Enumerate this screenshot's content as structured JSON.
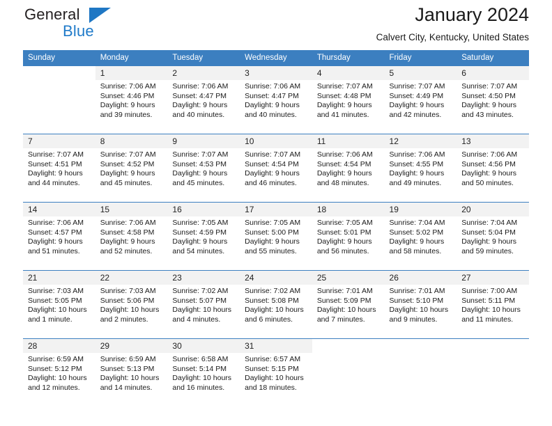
{
  "brand": {
    "name_part1": "General",
    "name_part2": "Blue",
    "triangle_color": "#1f77c4",
    "blue_color": "#1f7ac9"
  },
  "header": {
    "title": "January 2024",
    "subtitle": "Calvert City, Kentucky, United States"
  },
  "theme": {
    "header_blue": "#3c7fc0",
    "daynum_gray": "#f2f2f2",
    "text": "#1a1a1a"
  },
  "calendar": {
    "weekday_headers": [
      "Sunday",
      "Monday",
      "Tuesday",
      "Wednesday",
      "Thursday",
      "Friday",
      "Saturday"
    ],
    "weeks": [
      [
        {
          "day": "",
          "lines": []
        },
        {
          "day": "1",
          "lines": [
            "Sunrise: 7:06 AM",
            "Sunset: 4:46 PM",
            "Daylight: 9 hours",
            "and 39 minutes."
          ]
        },
        {
          "day": "2",
          "lines": [
            "Sunrise: 7:06 AM",
            "Sunset: 4:47 PM",
            "Daylight: 9 hours",
            "and 40 minutes."
          ]
        },
        {
          "day": "3",
          "lines": [
            "Sunrise: 7:06 AM",
            "Sunset: 4:47 PM",
            "Daylight: 9 hours",
            "and 40 minutes."
          ]
        },
        {
          "day": "4",
          "lines": [
            "Sunrise: 7:07 AM",
            "Sunset: 4:48 PM",
            "Daylight: 9 hours",
            "and 41 minutes."
          ]
        },
        {
          "day": "5",
          "lines": [
            "Sunrise: 7:07 AM",
            "Sunset: 4:49 PM",
            "Daylight: 9 hours",
            "and 42 minutes."
          ]
        },
        {
          "day": "6",
          "lines": [
            "Sunrise: 7:07 AM",
            "Sunset: 4:50 PM",
            "Daylight: 9 hours",
            "and 43 minutes."
          ]
        }
      ],
      [
        {
          "day": "7",
          "lines": [
            "Sunrise: 7:07 AM",
            "Sunset: 4:51 PM",
            "Daylight: 9 hours",
            "and 44 minutes."
          ]
        },
        {
          "day": "8",
          "lines": [
            "Sunrise: 7:07 AM",
            "Sunset: 4:52 PM",
            "Daylight: 9 hours",
            "and 45 minutes."
          ]
        },
        {
          "day": "9",
          "lines": [
            "Sunrise: 7:07 AM",
            "Sunset: 4:53 PM",
            "Daylight: 9 hours",
            "and 45 minutes."
          ]
        },
        {
          "day": "10",
          "lines": [
            "Sunrise: 7:07 AM",
            "Sunset: 4:54 PM",
            "Daylight: 9 hours",
            "and 46 minutes."
          ]
        },
        {
          "day": "11",
          "lines": [
            "Sunrise: 7:06 AM",
            "Sunset: 4:54 PM",
            "Daylight: 9 hours",
            "and 48 minutes."
          ]
        },
        {
          "day": "12",
          "lines": [
            "Sunrise: 7:06 AM",
            "Sunset: 4:55 PM",
            "Daylight: 9 hours",
            "and 49 minutes."
          ]
        },
        {
          "day": "13",
          "lines": [
            "Sunrise: 7:06 AM",
            "Sunset: 4:56 PM",
            "Daylight: 9 hours",
            "and 50 minutes."
          ]
        }
      ],
      [
        {
          "day": "14",
          "lines": [
            "Sunrise: 7:06 AM",
            "Sunset: 4:57 PM",
            "Daylight: 9 hours",
            "and 51 minutes."
          ]
        },
        {
          "day": "15",
          "lines": [
            "Sunrise: 7:06 AM",
            "Sunset: 4:58 PM",
            "Daylight: 9 hours",
            "and 52 minutes."
          ]
        },
        {
          "day": "16",
          "lines": [
            "Sunrise: 7:05 AM",
            "Sunset: 4:59 PM",
            "Daylight: 9 hours",
            "and 54 minutes."
          ]
        },
        {
          "day": "17",
          "lines": [
            "Sunrise: 7:05 AM",
            "Sunset: 5:00 PM",
            "Daylight: 9 hours",
            "and 55 minutes."
          ]
        },
        {
          "day": "18",
          "lines": [
            "Sunrise: 7:05 AM",
            "Sunset: 5:01 PM",
            "Daylight: 9 hours",
            "and 56 minutes."
          ]
        },
        {
          "day": "19",
          "lines": [
            "Sunrise: 7:04 AM",
            "Sunset: 5:02 PM",
            "Daylight: 9 hours",
            "and 58 minutes."
          ]
        },
        {
          "day": "20",
          "lines": [
            "Sunrise: 7:04 AM",
            "Sunset: 5:04 PM",
            "Daylight: 9 hours",
            "and 59 minutes."
          ]
        }
      ],
      [
        {
          "day": "21",
          "lines": [
            "Sunrise: 7:03 AM",
            "Sunset: 5:05 PM",
            "Daylight: 10 hours",
            "and 1 minute."
          ]
        },
        {
          "day": "22",
          "lines": [
            "Sunrise: 7:03 AM",
            "Sunset: 5:06 PM",
            "Daylight: 10 hours",
            "and 2 minutes."
          ]
        },
        {
          "day": "23",
          "lines": [
            "Sunrise: 7:02 AM",
            "Sunset: 5:07 PM",
            "Daylight: 10 hours",
            "and 4 minutes."
          ]
        },
        {
          "day": "24",
          "lines": [
            "Sunrise: 7:02 AM",
            "Sunset: 5:08 PM",
            "Daylight: 10 hours",
            "and 6 minutes."
          ]
        },
        {
          "day": "25",
          "lines": [
            "Sunrise: 7:01 AM",
            "Sunset: 5:09 PM",
            "Daylight: 10 hours",
            "and 7 minutes."
          ]
        },
        {
          "day": "26",
          "lines": [
            "Sunrise: 7:01 AM",
            "Sunset: 5:10 PM",
            "Daylight: 10 hours",
            "and 9 minutes."
          ]
        },
        {
          "day": "27",
          "lines": [
            "Sunrise: 7:00 AM",
            "Sunset: 5:11 PM",
            "Daylight: 10 hours",
            "and 11 minutes."
          ]
        }
      ],
      [
        {
          "day": "28",
          "lines": [
            "Sunrise: 6:59 AM",
            "Sunset: 5:12 PM",
            "Daylight: 10 hours",
            "and 12 minutes."
          ]
        },
        {
          "day": "29",
          "lines": [
            "Sunrise: 6:59 AM",
            "Sunset: 5:13 PM",
            "Daylight: 10 hours",
            "and 14 minutes."
          ]
        },
        {
          "day": "30",
          "lines": [
            "Sunrise: 6:58 AM",
            "Sunset: 5:14 PM",
            "Daylight: 10 hours",
            "and 16 minutes."
          ]
        },
        {
          "day": "31",
          "lines": [
            "Sunrise: 6:57 AM",
            "Sunset: 5:15 PM",
            "Daylight: 10 hours",
            "and 18 minutes."
          ]
        },
        {
          "day": "",
          "lines": []
        },
        {
          "day": "",
          "lines": []
        },
        {
          "day": "",
          "lines": []
        }
      ]
    ]
  }
}
